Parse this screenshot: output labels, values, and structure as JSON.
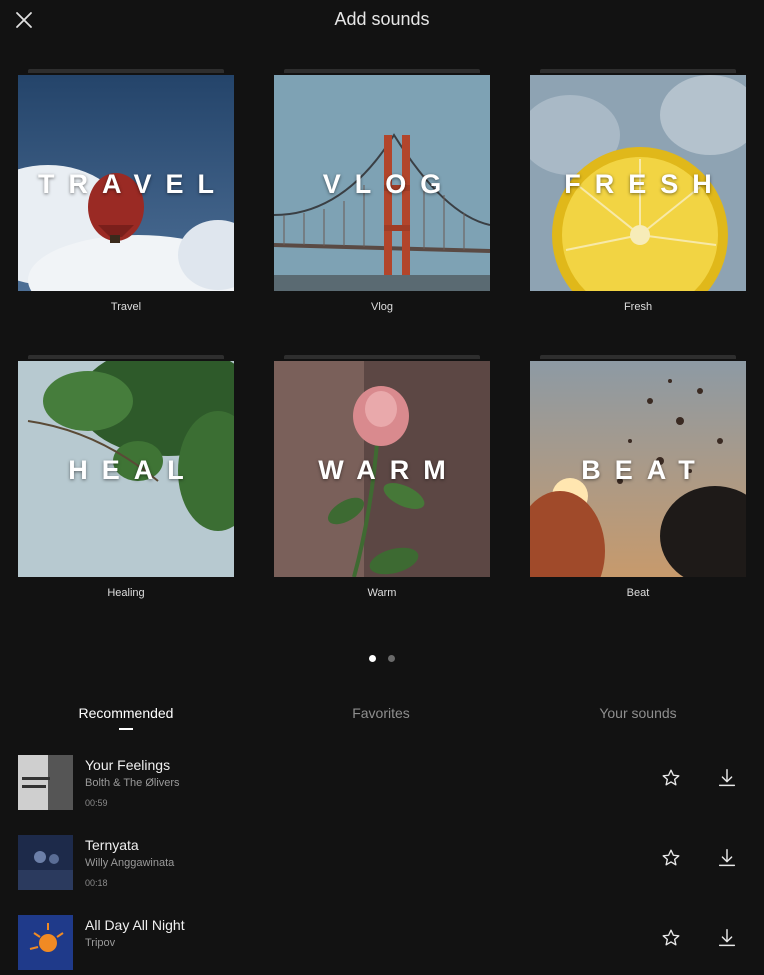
{
  "header": {
    "title": "Add sounds",
    "close_icon": "close-icon"
  },
  "categories": [
    {
      "word": "TRAVEL",
      "label": "Travel"
    },
    {
      "word": "VLOG",
      "label": "Vlog"
    },
    {
      "word": "FRESH",
      "label": "Fresh"
    },
    {
      "word": "HEAL",
      "label": "Healing"
    },
    {
      "word": "WARM",
      "label": "Warm"
    },
    {
      "word": "BEAT",
      "label": "Beat"
    }
  ],
  "pagination": {
    "pages": 2,
    "current": 1
  },
  "tabs": [
    {
      "label": "Recommended",
      "active": true
    },
    {
      "label": "Favorites",
      "active": false
    },
    {
      "label": "Your sounds",
      "active": false
    }
  ],
  "tracks": [
    {
      "title": "Your Feelings",
      "artist": "Bolth & The Ølivers",
      "duration": "00:59"
    },
    {
      "title": "Ternyata",
      "artist": "Willy Anggawinata",
      "duration": "00:18"
    },
    {
      "title": "All Day All Night",
      "artist": "Tripov",
      "duration": ""
    }
  ],
  "colors": {
    "background": "#121212",
    "text": "#ffffff",
    "muted": "#8e8e8e"
  }
}
